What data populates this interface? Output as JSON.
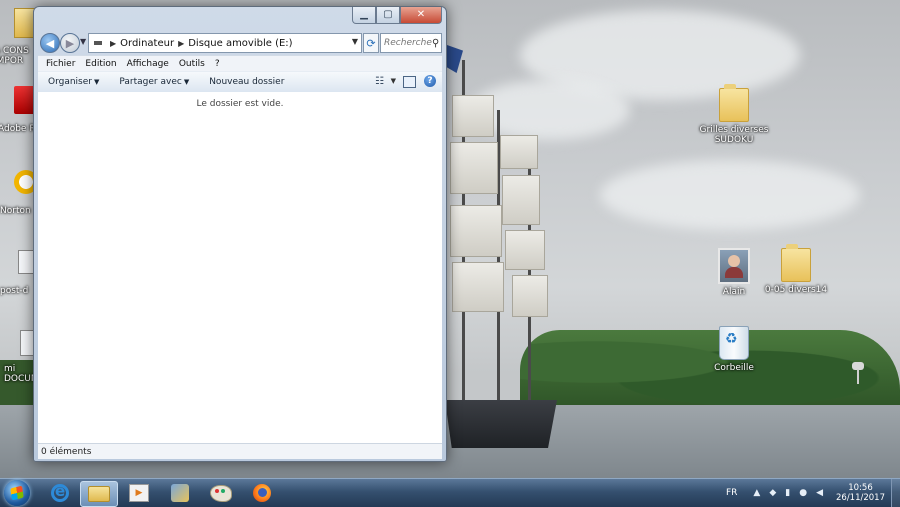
{
  "window": {
    "breadcrumb": [
      "Ordinateur",
      "Disque amovible (E:)"
    ],
    "search_placeholder": "Rechercher ...",
    "menu": [
      "Fichier",
      "Edition",
      "Affichage",
      "Outils",
      "?"
    ],
    "commands": {
      "organize": "Organiser",
      "share": "Partager avec",
      "new_folder": "Nouveau dossier"
    },
    "empty_message": "Le dossier est vide.",
    "status": "0 éléments"
  },
  "desktop": {
    "left_icons": [
      "A CONS IMPOR",
      "Adobe R",
      "Norton",
      "post-d",
      "mi DOCUM"
    ],
    "icons": [
      {
        "label": "Grilles diverses SUDOKU",
        "icon": "folder-icon"
      },
      {
        "label": "Alain",
        "icon": "user-avatar-icon"
      },
      {
        "label": "0-05 divers14",
        "icon": "folder-icon"
      },
      {
        "label": "Corbeille",
        "icon": "recycle-bin-icon"
      }
    ]
  },
  "taskbar": {
    "language": "FR",
    "time": "10:56",
    "date": "26/11/2017",
    "pinned": [
      "start-button",
      "internet-explorer-icon",
      "windows-explorer-icon",
      "media-player-icon",
      "tool-icon",
      "paint-icon",
      "firefox-icon"
    ]
  },
  "colors": {
    "taskbar": "#35506f",
    "window_frame": "#c5d3e4",
    "close_button": "#c74a35"
  }
}
